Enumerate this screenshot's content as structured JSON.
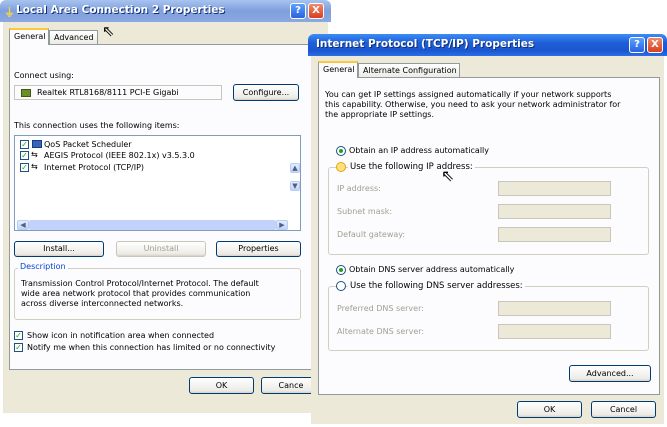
{
  "win1": {
    "title": "Local Area Connection 2 Properties",
    "help_btn": "?",
    "close_btn": "X",
    "tabs": [
      "General",
      "Advanced"
    ],
    "connect_using_label": "Connect using:",
    "adapter_name": "Realtek RTL8168/8111 PCI-E Gigabi",
    "configure_button": "Configure...",
    "items_label": "This connection uses the following items:",
    "items": [
      "QoS Packet Scheduler",
      "AEGIS Protocol (IEEE 802.1x) v3.5.3.0",
      "Internet Protocol (TCP/IP)"
    ],
    "install_button": "Install...",
    "uninstall_button": "Uninstall",
    "properties_button": "Properties",
    "description_label": "Description",
    "description_lines": [
      "Transmission Control Protocol/Internet Protocol. The default",
      "wide area network protocol that provides communication",
      "across diverse interconnected networks."
    ],
    "show_icon_label": "Show icon in notification area when connected",
    "notify_label": "Notify me when this connection has limited or no connectivity",
    "ok_button": "OK",
    "cancel_button": "Cance"
  },
  "win2": {
    "title": "Internet Protocol (TCP/IP) Properties",
    "help_btn": "?",
    "close_btn": "X",
    "tabs": [
      "General",
      "Alternate Configuration"
    ],
    "intro_lines": [
      "You can get IP settings assigned automatically if your network supports",
      "this capability. Otherwise, you need to ask your network administrator for",
      "the appropriate IP settings."
    ],
    "obtain_ip_auto": "Obtain an IP address automatically",
    "use_following_ip": "Use the following IP address:",
    "ip_address_label": "IP address:",
    "subnet_mask_label": "Subnet mask:",
    "default_gateway_label": "Default gateway:",
    "obtain_dns_auto": "Obtain DNS server address automatically",
    "use_following_dns": "Use the following DNS server addresses:",
    "preferred_dns_label": "Preferred DNS server:",
    "alternate_dns_label": "Alternate DNS server:",
    "advanced_button": "Advanced...",
    "ok_button": "OK",
    "cancel_button": "Cancel"
  },
  "colors": {
    "title_active": "#1f5fd6",
    "dialog_bg": "#ece9d8",
    "check_green": "#21a121"
  }
}
